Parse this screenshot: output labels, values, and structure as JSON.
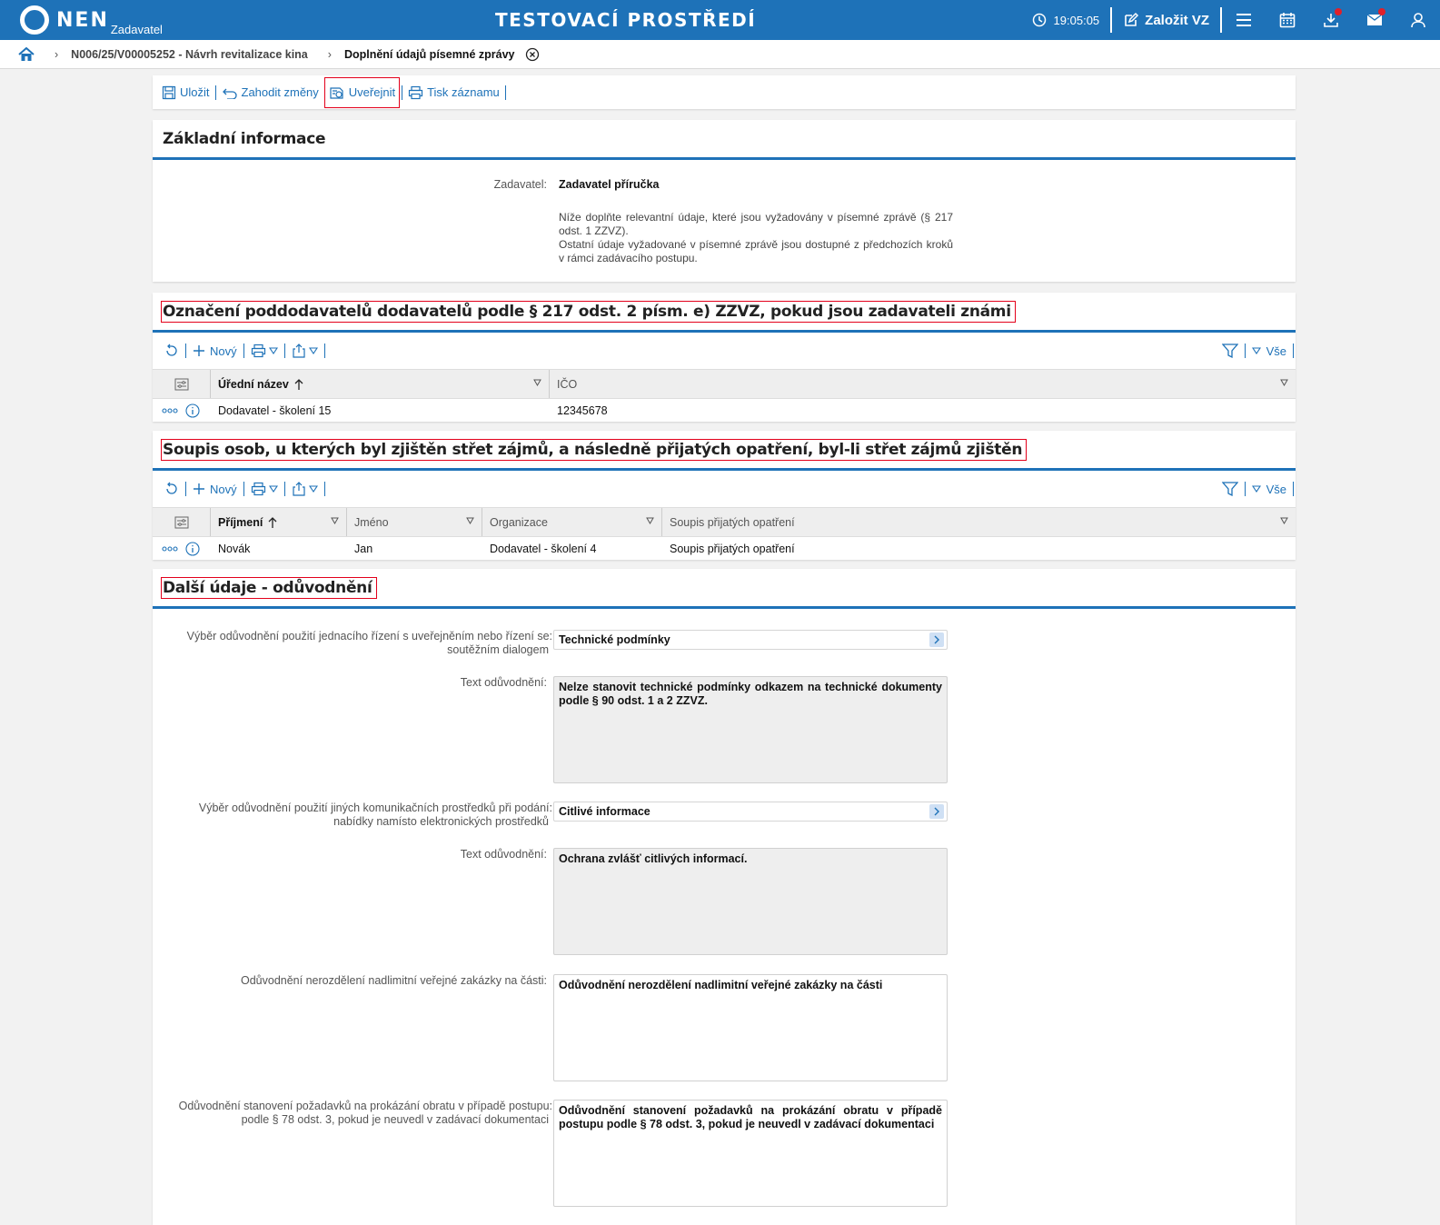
{
  "header": {
    "logo_text": "NEN",
    "logo_sub": "Zadavatel",
    "env_title": "TESTOVACÍ PROSTŘEDÍ",
    "time": "19:05:05",
    "create_label": "Založit VZ",
    "icons": [
      "clock-icon",
      "edit-icon",
      "menu-icon",
      "calendar-icon",
      "download-icon",
      "mail-icon",
      "user-icon"
    ],
    "brand_color": "#1e72b8",
    "notification_color": "#e0202a"
  },
  "breadcrumb": {
    "item1": "N006/25/V00005252 - Návrh revitalizace kina",
    "current": "Doplnění údajů písemné zprávy"
  },
  "toolbar": {
    "save": "Uložit",
    "discard": "Zahodit změny",
    "publish": "Uveřejnit",
    "print": "Tisk záznamu"
  },
  "basic": {
    "title": "Základní informace",
    "zadavatel_label": "Zadavatel:",
    "zadavatel_value": "Zadavatel příručka",
    "note1": "Níže doplňte relevantní údaje, které jsou vyžadovány v písemné zprávě (§ 217 odst. 1 ZZVZ).",
    "note2": "Ostatní údaje vyžadované v písemné zprávě jsou dostupné z předchozích kroků v rámci zadávacího postupu."
  },
  "subcontractors": {
    "title": "Označení poddodavatelů dodavatelů podle § 217 odst. 2 písm. e) ZZVZ, pokud jsou zadavateli známi",
    "new_label": "Nový",
    "all_label": "Vše",
    "columns": [
      "Úřední název",
      "IČO"
    ],
    "rows": [
      {
        "name": "Dodavatel - školení 15",
        "ico": "12345678"
      }
    ]
  },
  "conflicts": {
    "title": "Soupis osob, u kterých byl zjištěn střet zájmů, a následně přijatých opatření, byl-li střet zájmů zjištěn",
    "new_label": "Nový",
    "all_label": "Vše",
    "columns": [
      "Příjmení",
      "Jméno",
      "Organizace",
      "Soupis přijatých opatření"
    ],
    "rows": [
      {
        "surname": "Novák",
        "name": "Jan",
        "org": "Dodavatel - školení 4",
        "measures": "Soupis přijatých opatření"
      }
    ]
  },
  "justification": {
    "title": "Další údaje - odůvodnění",
    "f1_label1": "Výběr odůvodnění použití jednacího řízení s uveřejněním nebo řízení se:",
    "f1_label2": "soutěžním dialogem",
    "f1_value": "Technické podmínky",
    "f2_label": "Text odůvodnění:",
    "f2_value": "Nelze stanovit technické podmínky odkazem na technické dokumenty podle § 90 odst. 1 a 2 ZZVZ.",
    "f3_label1": "Výběr odůvodnění použití jiných komunikačních prostředků při podání:",
    "f3_label2": "nabídky namísto elektronických prostředků",
    "f3_value": "Citlivé informace",
    "f4_label": "Text odůvodnění:",
    "f4_value": "Ochrana zvlášť citlivých informací.",
    "f5_label": "Odůvodnění nerozdělení nadlimitní veřejné zakázky na části:",
    "f5_value": "Odůvodnění nerozdělení nadlimitní veřejné zakázky na části",
    "f6_label1": "Odůvodnění stanovení požadavků na prokázání obratu v případě postupu:",
    "f6_label2": "podle § 78 odst. 3, pokud je neuvedl v zadávací dokumentaci",
    "f6_value": "Odůvodnění stanovení požadavků na prokázání obratu v případě postupu podle § 78 odst. 3, pokud je neuvedl v zadávací dokumentaci"
  }
}
